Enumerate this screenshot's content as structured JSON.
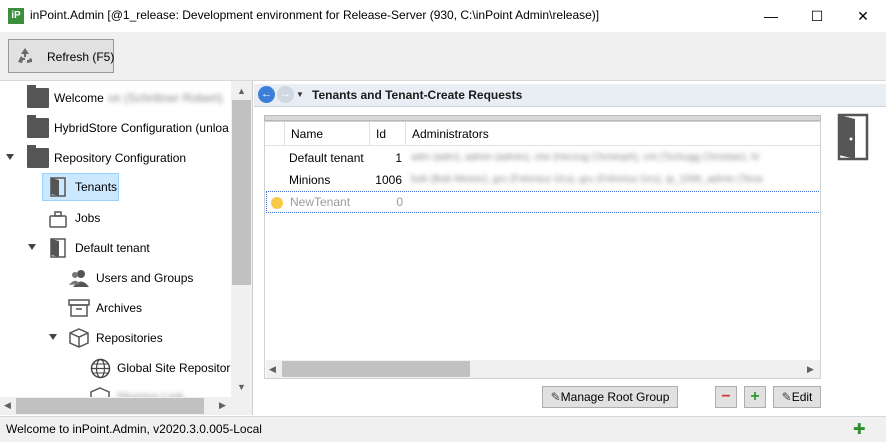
{
  "window": {
    "logo_text": "iP",
    "title": "inPoint.Admin [@1_release: Development environment for Release-Server (930, C:\\inPoint Admin\\release)]",
    "minimize": "—",
    "maximize": "☐",
    "close": "✕"
  },
  "toolbar": {
    "refresh_label": "Refresh (F5)",
    "refresh_icon": "recycle-icon"
  },
  "tree": {
    "items": [
      {
        "label": "Welcome",
        "extra": "ve (Schrittner Robert)"
      },
      {
        "label": "HybridStore Configuration (unloa"
      },
      {
        "label": "Repository Configuration"
      },
      {
        "label": "Tenants"
      },
      {
        "label": "Jobs"
      },
      {
        "label": "Default tenant"
      },
      {
        "label": "Users and Groups"
      },
      {
        "label": "Archives"
      },
      {
        "label": "Repositories"
      },
      {
        "label": "Global Site Repositori"
      },
      {
        "label": "Sharing Link..."
      }
    ]
  },
  "nav": {
    "back": "←",
    "forward": "→",
    "dropdown": "▼",
    "breadcrumb": "Tenants and Tenant-Create Requests"
  },
  "grid": {
    "columns": [
      "Name",
      "Id",
      "Administrators"
    ],
    "rows": [
      {
        "name": "Default tenant",
        "id": "1",
        "admins": "adm (adm), admin (admin), che (Herzog Christoph), crit (Tschugg Christian), hr"
      },
      {
        "name": "Minions",
        "id": "1006",
        "admins": "bob (Bob Minion), gru (Felonius Gru), gru (Felonius Gru), ip_1006_admin (Tena"
      }
    ],
    "new_row": {
      "name": "NewTenant",
      "id": "0"
    }
  },
  "actions": {
    "manage_root_group": "Manage Root Group",
    "remove": "−",
    "add": "+",
    "edit": "Edit"
  },
  "status": {
    "text": "Welcome to inPoint.Admin, v2020.3.0.005-Local"
  },
  "colors": {
    "accent_blue": "#3d7fd6",
    "nav_bg": "#e9eef5",
    "remove_red": "#d9363e",
    "add_green": "#2f9a2f"
  }
}
